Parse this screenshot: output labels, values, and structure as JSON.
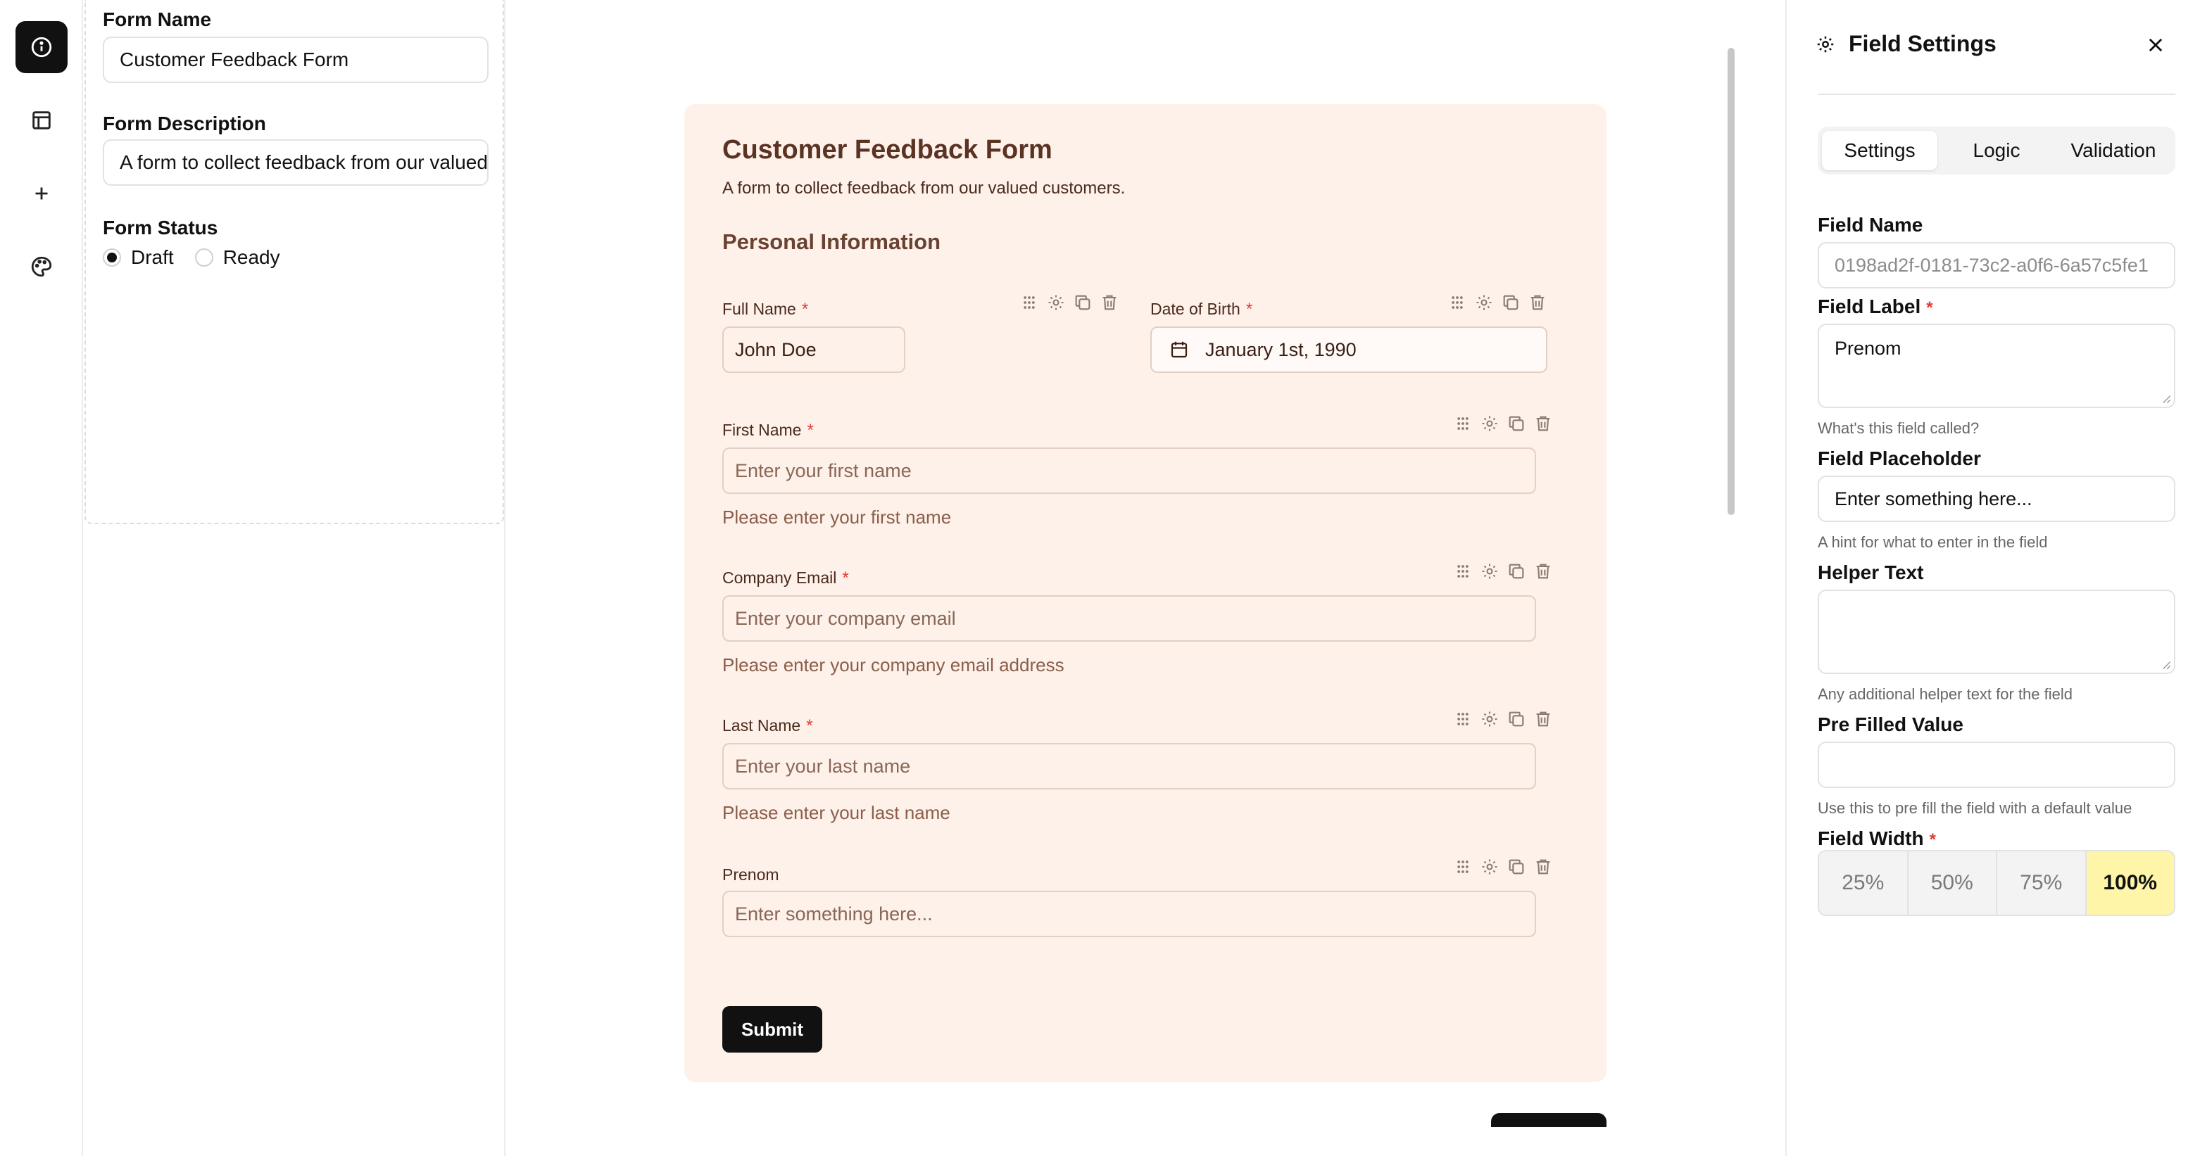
{
  "rail": {
    "items": [
      {
        "icon": "info-icon",
        "active": true
      },
      {
        "icon": "layout-icon",
        "active": false
      },
      {
        "icon": "plus-icon",
        "active": false
      },
      {
        "icon": "palette-icon",
        "active": false
      }
    ]
  },
  "form_settings": {
    "name_label": "Form Name",
    "name_value": "Customer Feedback Form",
    "description_label": "Form Description",
    "description_value": "A form to collect feedback from our valued customers.",
    "status_label": "Form Status",
    "status_options": [
      "Draft",
      "Ready"
    ],
    "status_selected": "Draft"
  },
  "form": {
    "title": "Customer Feedback Form",
    "description": "A form to collect feedback from our valued customers.",
    "section_title": "Personal Information",
    "fields": {
      "full_name": {
        "label": "Full Name",
        "value": "John Doe",
        "required": "*"
      },
      "dob": {
        "label": "Date of Birth",
        "value": "January 1st, 1990",
        "required": "*"
      },
      "first_name": {
        "label": "First Name",
        "placeholder": "Enter your first name",
        "helper": "Please enter your first name",
        "required": "*"
      },
      "company_email": {
        "label": "Company Email",
        "placeholder": "Enter your company email",
        "helper": "Please enter your company email address",
        "required": "*"
      },
      "last_name": {
        "label": "Last Name",
        "placeholder": "Enter your last name",
        "helper": "Please enter your last name",
        "required": "*"
      },
      "prenom": {
        "label": "Prenom",
        "placeholder": "Enter something here..."
      }
    },
    "submit_label": "Submit"
  },
  "field_settings": {
    "title": "Field Settings",
    "tabs": [
      "Settings",
      "Logic",
      "Validation"
    ],
    "active_tab": "Settings",
    "field_name_label": "Field Name",
    "field_name_value": "0198ad2f-0181-73c2-a0f6-6a57c5fe1",
    "field_label_label": "Field Label",
    "field_label_value": "Prenom",
    "field_label_hint": "What's this field called?",
    "placeholder_label": "Field Placeholder",
    "placeholder_value": "Enter something here...",
    "placeholder_hint": "A hint for what to enter in the field",
    "helper_label": "Helper Text",
    "helper_value": "",
    "helper_hint": "Any additional helper text for the field",
    "prefilled_label": "Pre Filled Value",
    "prefilled_value": "",
    "prefilled_hint": "Use this to pre fill the field with a default value",
    "width_label": "Field Width",
    "width_options": [
      "25%",
      "50%",
      "75%",
      "100%"
    ],
    "width_selected": "100%",
    "required_mark": "*"
  },
  "colors": {
    "card_background": "#fdf1ea",
    "accent_yellow": "#fff5a8",
    "required_red": "#e53935",
    "title_brown": "#5b3322"
  }
}
